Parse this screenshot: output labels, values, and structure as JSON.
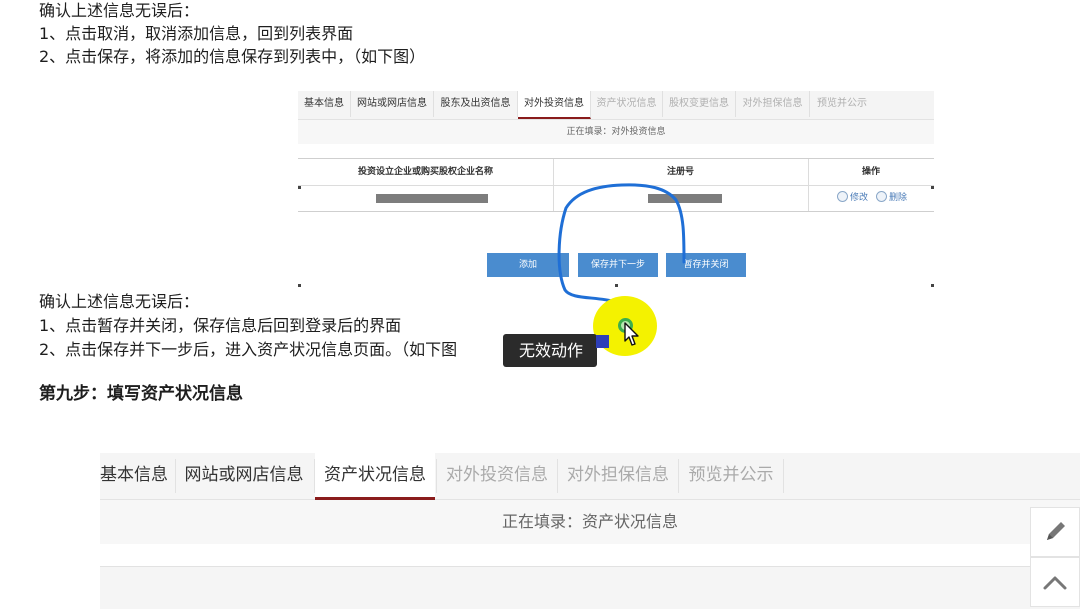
{
  "doc": {
    "block1": [
      "确认上述信息无误后：",
      "1、点击取消，取消添加信息，回到列表界面",
      "2、点击保存，将添加的信息保存到列表中，（如下图）"
    ],
    "block2": [
      "确认上述信息无误后：",
      "1、点击暂存并关闭，保存信息后回到登录后的界面",
      "2、点击保存并下一步后，进入资产状况信息页面。（如下图"
    ],
    "step_heading": "第九步：填写资产状况信息"
  },
  "small_shot": {
    "tabs": [
      "基本信息",
      "网站或网店信息",
      "股东及出资信息",
      "对外投资信息",
      "资产状况信息",
      "股权变更信息",
      "对外担保信息",
      "预览并公示"
    ],
    "active_tab": "对外投资信息",
    "filling_label": "正在填录：对外投资信息",
    "table_headers": [
      "投资设立企业或购买股权企业名称",
      "注册号",
      "操作"
    ],
    "row_actions": [
      "修改",
      "删除"
    ],
    "buttons": [
      "添加",
      "保存并下一步",
      "暂存并关闭"
    ]
  },
  "tooltip": "无效动作",
  "big_ui": {
    "tabs": [
      "基本信息",
      "网站或网店信息",
      "资产状况信息",
      "对外投资信息",
      "对外担保信息",
      "预览并公示"
    ],
    "active_tab": "资产状况信息",
    "filling_label": "正在填录：资产状况信息"
  },
  "side_tools": [
    "edit-icon",
    "back-to-top-icon"
  ],
  "colors": {
    "active_tab_underline": "#8a1c1c",
    "button_blue": "#4a8ccf",
    "ink_blue": "#1f6fd6",
    "cursor_highlight": "#f4f200",
    "tooltip_bg": "#2b2b2b"
  }
}
